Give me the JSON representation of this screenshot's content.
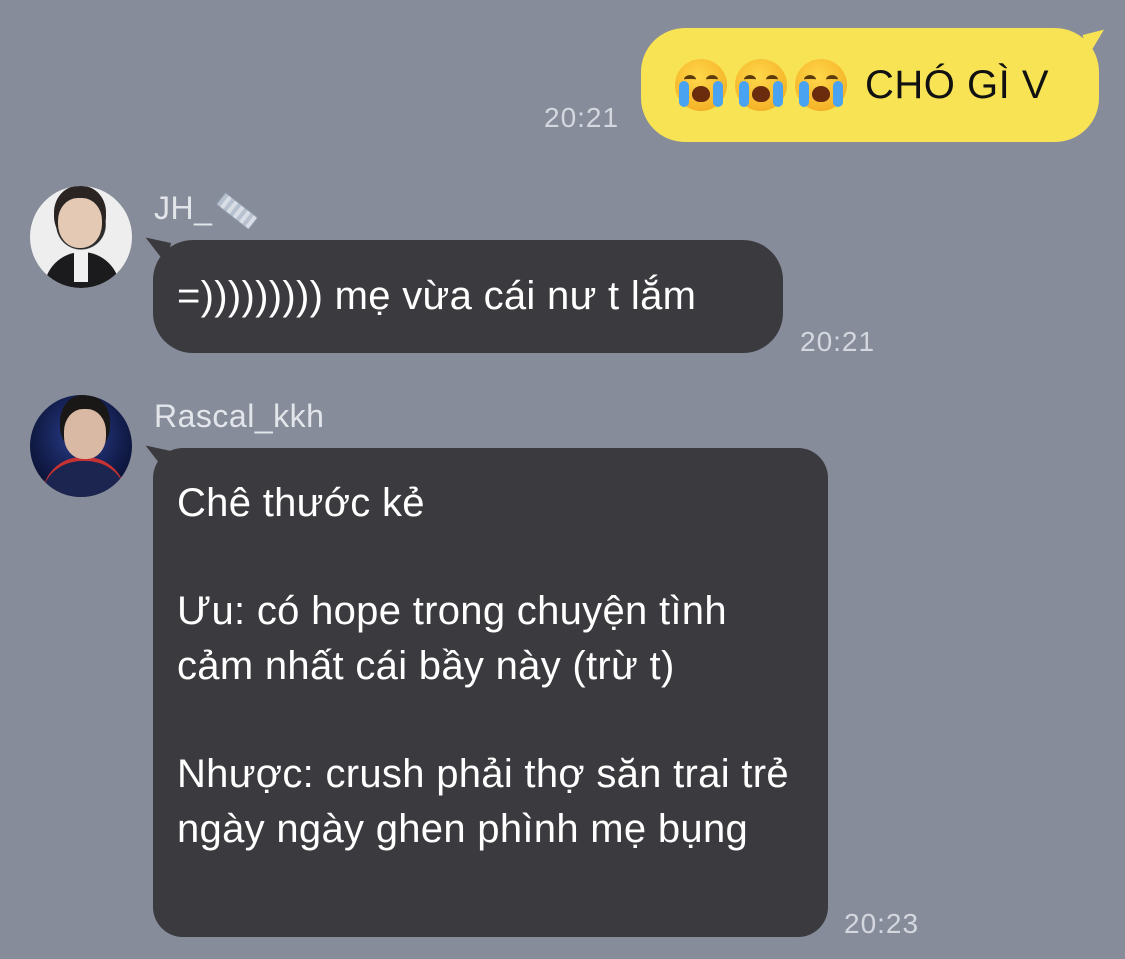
{
  "messages": {
    "outgoing": {
      "emoji": "crying-face-icon",
      "emoji_count": 3,
      "text": "CHÓ GÌ V",
      "time": "20:21",
      "bubble_color": "#f7e354"
    },
    "jh": {
      "sender": "JH_",
      "sender_icon": "ruler-icon",
      "text": "=))))))))) mẹ vừa cái nư t lắm",
      "time": "20:21"
    },
    "rascal": {
      "sender": "Rascal_kkh",
      "paragraphs": [
        "Chê thước kẻ",
        "Ưu: có hope trong chuyện tình cảm nhất cái bầy này (trừ t)",
        "Nhược: crush phải thợ săn trai trẻ ngày ngày ghen phình mẹ bụng"
      ],
      "time": "20:23"
    }
  },
  "colors": {
    "background": "#878c9b",
    "incoming_bubble": "#3b3b3f",
    "outgoing_bubble": "#f7e354"
  }
}
